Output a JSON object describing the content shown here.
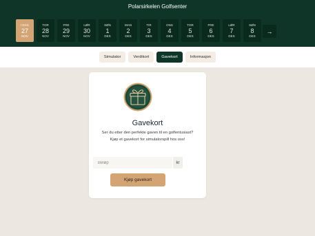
{
  "header": {
    "title": "Polarsirkelen Golfsenter",
    "next_arrow": "→"
  },
  "dates": [
    {
      "weekday": "I DAG",
      "day": "27",
      "month": "NOV",
      "active": true
    },
    {
      "weekday": "TOR",
      "day": "28",
      "month": "NOV",
      "active": false
    },
    {
      "weekday": "FRE",
      "day": "29",
      "month": "NOV",
      "active": false
    },
    {
      "weekday": "LØR",
      "day": "30",
      "month": "NOV",
      "active": false
    },
    {
      "weekday": "SØN",
      "day": "1",
      "month": "DES",
      "active": false
    },
    {
      "weekday": "MAN",
      "day": "2",
      "month": "DES",
      "active": false
    },
    {
      "weekday": "TIR",
      "day": "3",
      "month": "DES",
      "active": false
    },
    {
      "weekday": "ONS",
      "day": "4",
      "month": "DES",
      "active": false
    },
    {
      "weekday": "TOR",
      "day": "5",
      "month": "DES",
      "active": false
    },
    {
      "weekday": "FRE",
      "day": "6",
      "month": "DES",
      "active": false
    },
    {
      "weekday": "LØR",
      "day": "7",
      "month": "DES",
      "active": false
    },
    {
      "weekday": "SØN",
      "day": "8",
      "month": "DES",
      "active": false
    }
  ],
  "tabs": [
    {
      "label": "Simulator",
      "active": false
    },
    {
      "label": "Verdikort",
      "active": false
    },
    {
      "label": "Gavekort",
      "active": true
    },
    {
      "label": "Informasjon",
      "active": false
    }
  ],
  "card": {
    "icon": "gift-icon",
    "title": "Gavekort",
    "description": "Ser du etter den perfekte gaven til en golfentusiast? Kjøp et gavekort for simulatorspill hos oss!",
    "amount_placeholder": "Beløp",
    "amount_value": "",
    "currency": "kr",
    "buy_label": "Kjøp gavekort"
  },
  "colors": {
    "header_bg": "#0e3527",
    "accent": "#d4a574",
    "page_bg": "#ece8e1"
  }
}
